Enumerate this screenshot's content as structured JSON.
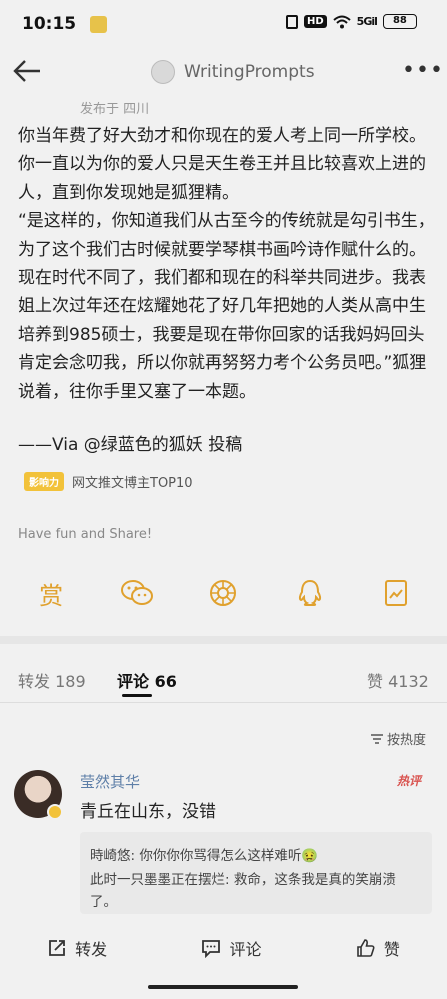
{
  "status": {
    "time": "10:15",
    "hd": "HD",
    "signal": "5Gil",
    "battery": "88"
  },
  "nav": {
    "title": "WritingPrompts",
    "more": "•••"
  },
  "post": {
    "location": "发布于 四川",
    "paragraphs": [
      "你当年费了好大劲才和你现在的爱人考上同一所学校。你一直以为你的爱人只是天生卷王并且比较喜欢上进的人，直到你发现她是狐狸精。",
      "“是这样的，你知道我们从古至今的传统就是勾引书生，为了这个我们古时候就要学琴棋书画吟诗作赋什么的。现在时代不同了，我们都和现在的科举共同进步。我表姐上次过年还在炫耀她花了好几年把她的人类从高中生培养到985硕士，我要是现在带你回家的话我妈妈回头肯定会念叨我，所以你就再努努力考个公务员吧。”狐狸说着，往你手里又塞了一本题。"
    ],
    "via": "——Via @绿蓝色的狐妖 投稿",
    "badge": "影响力",
    "badge_text": "网文推文博主TOP10",
    "share_note": "Have fun and Share!",
    "share_shang": "赏"
  },
  "tabs": {
    "repost": "转发 189",
    "comment": "评论 66",
    "like": "赞 4132"
  },
  "sort_label": "按热度",
  "comment": {
    "user": "莹然其华",
    "hot": "热评",
    "text": "青丘在山东，没错",
    "replies": [
      {
        "user": "時崎悠:",
        "text": "你你你你骂得怎么这样难听🤢"
      },
      {
        "user": "此时一只墨墨正在摆烂:",
        "text": "救命，这条我是真的笑崩溃了。"
      }
    ]
  },
  "bottom": {
    "repost": "转发",
    "comment": "评论",
    "like": "赞"
  },
  "icons": {
    "back": "back-arrow-icon",
    "wechat": "wechat-icon",
    "moments": "moments-icon",
    "qq": "qq-icon",
    "qzone": "qzone-icon"
  }
}
